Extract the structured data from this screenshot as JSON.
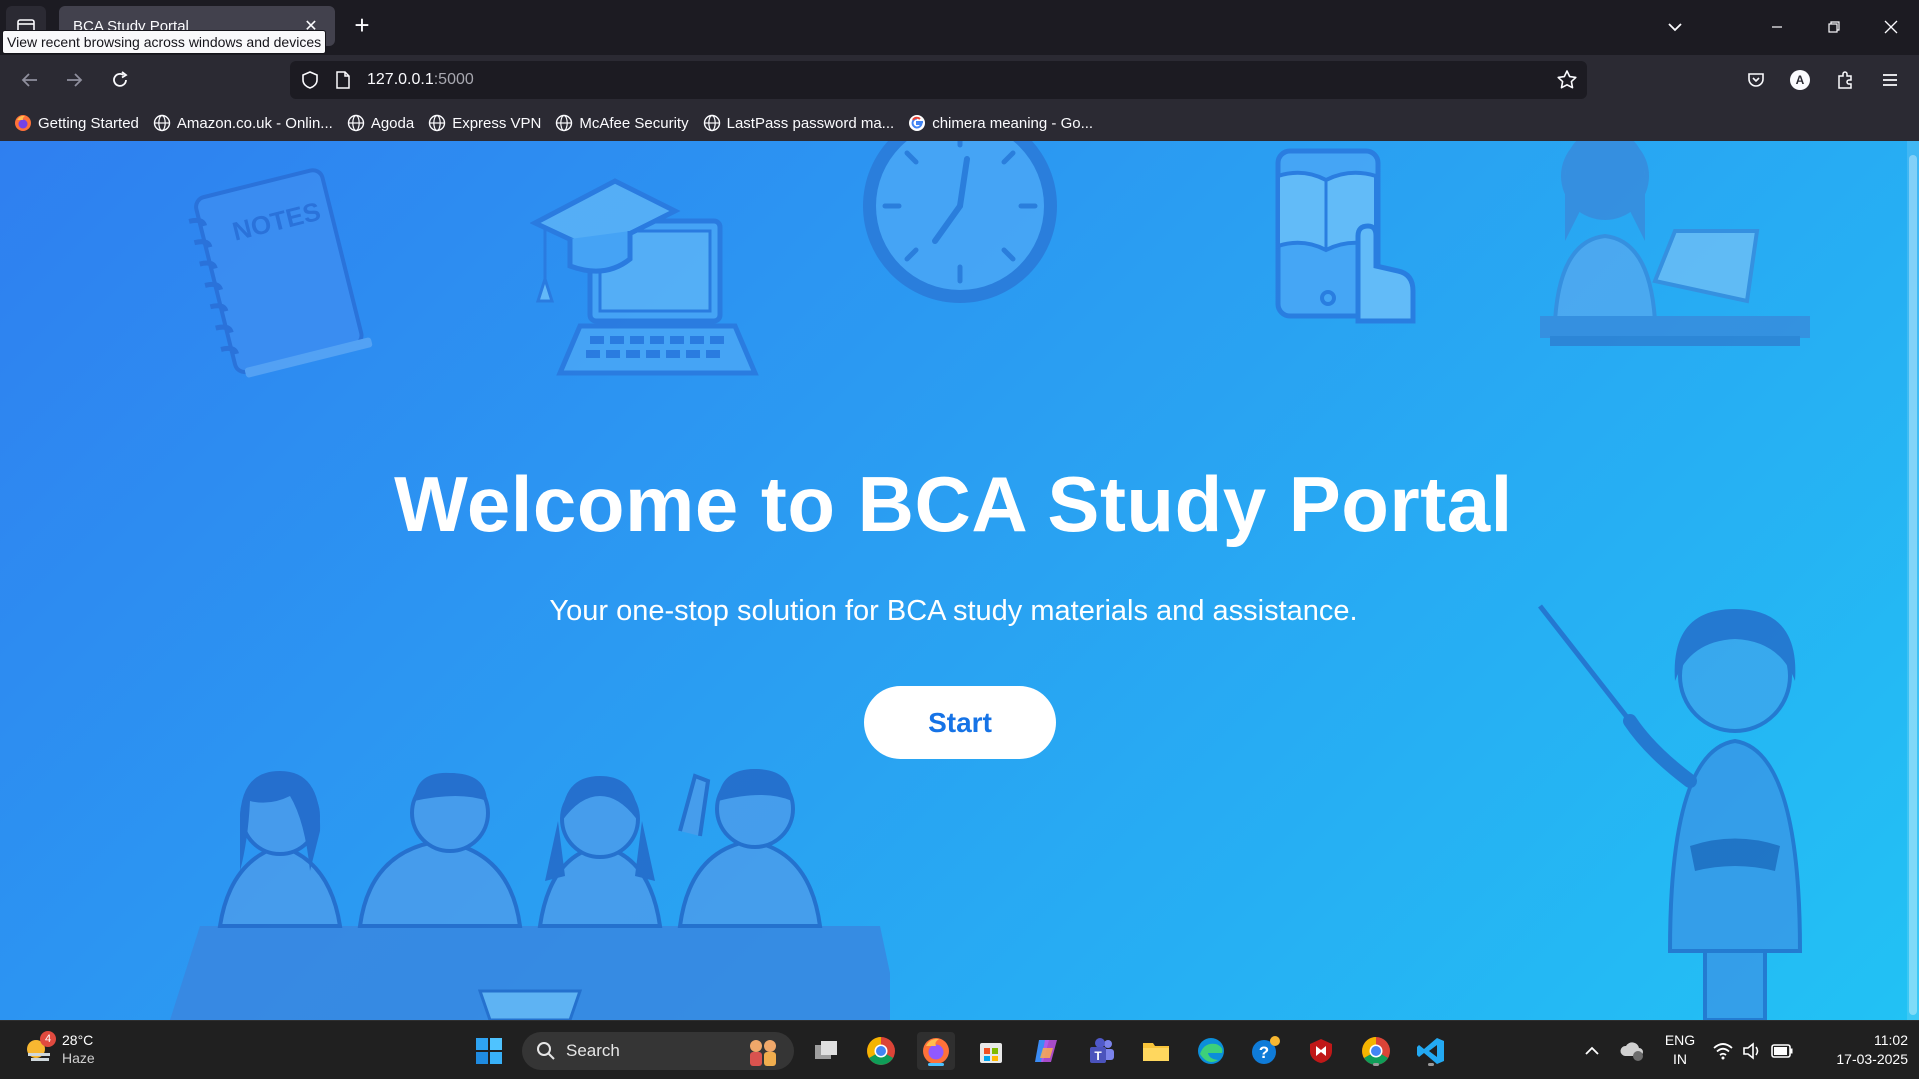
{
  "browser": {
    "tab_title": "BCA Study Portal",
    "tooltip": "View recent browsing across windows and devices",
    "url_host": "127.0.0.1",
    "url_port": ":5000",
    "profile_letter": "A"
  },
  "bookmarks": [
    {
      "label": "Getting Started",
      "icon": "firefox-icon"
    },
    {
      "label": "Amazon.co.uk - Onlin...",
      "icon": "globe-icon"
    },
    {
      "label": "Agoda",
      "icon": "globe-icon"
    },
    {
      "label": "Express VPN",
      "icon": "globe-icon"
    },
    {
      "label": "McAfee Security",
      "icon": "globe-icon"
    },
    {
      "label": "LastPass password ma...",
      "icon": "globe-icon"
    },
    {
      "label": "chimera meaning - Go...",
      "icon": "google-icon"
    }
  ],
  "page": {
    "title": "Welcome to BCA Study Portal",
    "subtitle": "Your one-stop solution for BCA study materials and assistance.",
    "start_label": "Start",
    "notes_label": "NOTES"
  },
  "taskbar": {
    "weather_temp": "28°C",
    "weather_cond": "Haze",
    "weather_badge": "4",
    "search_placeholder": "Search",
    "lang_top": "ENG",
    "lang_bottom": "IN",
    "time": "11:02",
    "date": "17-03-2025"
  },
  "colors": {
    "page_gradient_start": "#2f7ff0",
    "page_gradient_end": "#22c2f4",
    "button_text": "#1673e6"
  }
}
